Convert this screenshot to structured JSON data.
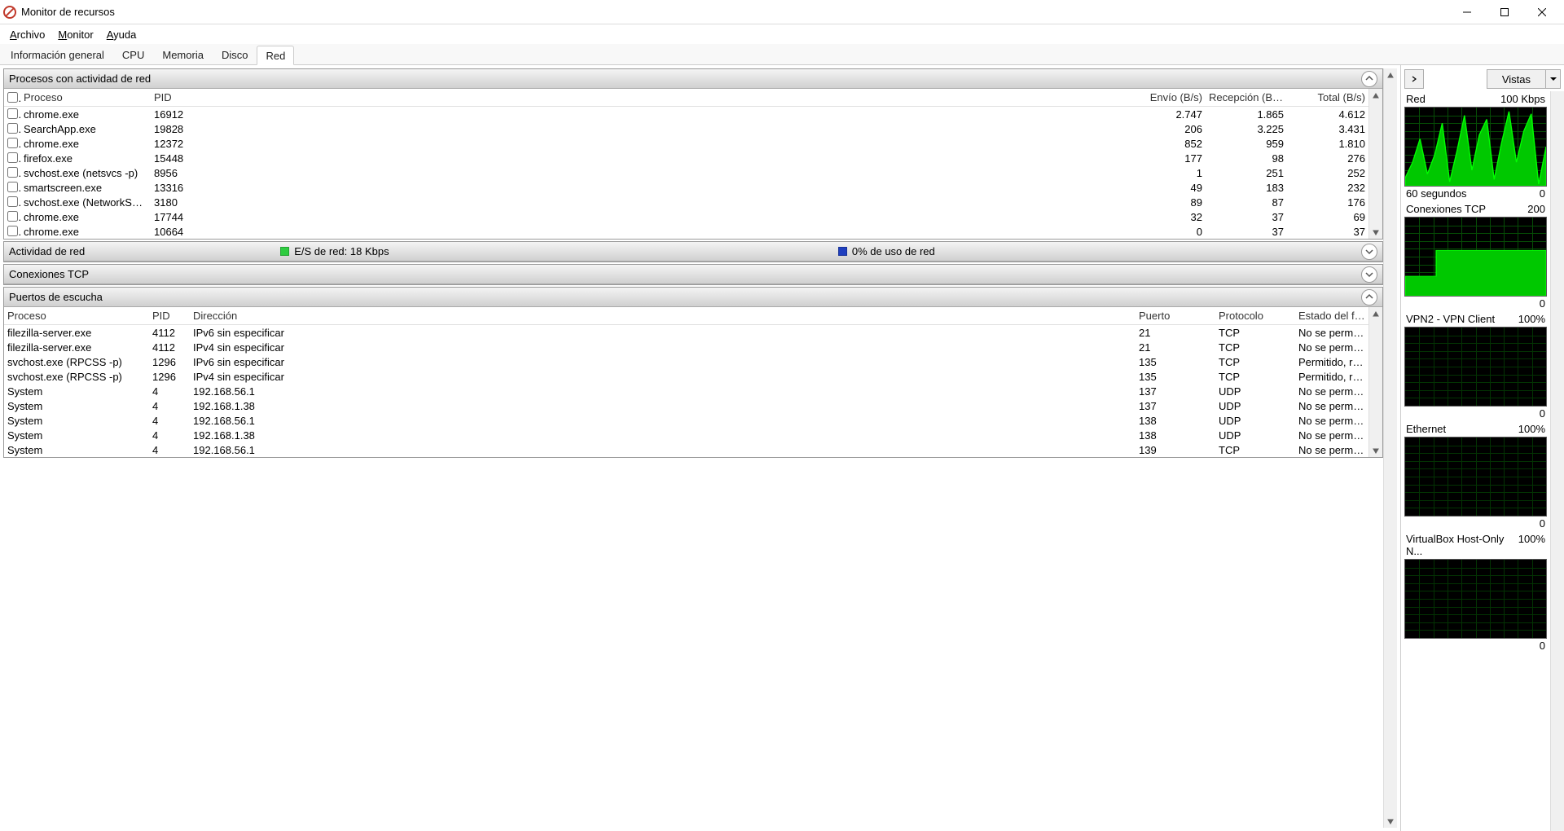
{
  "window": {
    "title": "Monitor de recursos"
  },
  "menus": [
    "Archivo",
    "Monitor",
    "Ayuda"
  ],
  "menu_mnemonics": [
    "A",
    "M",
    "A"
  ],
  "tabs": [
    {
      "label": "Información general",
      "mnemonic": "g",
      "active": false
    },
    {
      "label": "CPU",
      "active": false
    },
    {
      "label": "Memoria",
      "active": false
    },
    {
      "label": "Disco",
      "active": false
    },
    {
      "label": "Red",
      "active": true
    }
  ],
  "panels": {
    "processes": {
      "title": "Procesos con actividad de red",
      "columns": [
        "Proceso",
        "PID",
        "Envío (B/s)",
        "Recepción (B/s)",
        "Total (B/s)"
      ],
      "rows": [
        {
          "proc": "chrome.exe",
          "pid": "16912",
          "send": "2.747",
          "recv": "1.865",
          "total": "4.612"
        },
        {
          "proc": "SearchApp.exe",
          "pid": "19828",
          "send": "206",
          "recv": "3.225",
          "total": "3.431"
        },
        {
          "proc": "chrome.exe",
          "pid": "12372",
          "send": "852",
          "recv": "959",
          "total": "1.810"
        },
        {
          "proc": "firefox.exe",
          "pid": "15448",
          "send": "177",
          "recv": "98",
          "total": "276"
        },
        {
          "proc": "svchost.exe (netsvcs -p)",
          "pid": "8956",
          "send": "1",
          "recv": "251",
          "total": "252"
        },
        {
          "proc": "smartscreen.exe",
          "pid": "13316",
          "send": "49",
          "recv": "183",
          "total": "232"
        },
        {
          "proc": "svchost.exe (NetworkService -p)",
          "pid": "3180",
          "send": "89",
          "recv": "87",
          "total": "176"
        },
        {
          "proc": "chrome.exe",
          "pid": "17744",
          "send": "32",
          "recv": "37",
          "total": "69"
        },
        {
          "proc": "chrome.exe",
          "pid": "10664",
          "send": "0",
          "recv": "37",
          "total": "37"
        }
      ]
    },
    "activity": {
      "title": "Actividad de red",
      "io_label": "E/S de red: 18 Kbps",
      "io_color": "#2ecc40",
      "usage_label": "0% de uso de red",
      "usage_color": "#1f3fbf"
    },
    "tcp": {
      "title": "Conexiones TCP"
    },
    "ports": {
      "title": "Puertos de escucha",
      "columns": [
        "Proceso",
        "PID",
        "Dirección",
        "Puerto",
        "Protocolo",
        "Estado del firewall"
      ],
      "rows": [
        {
          "proc": "filezilla-server.exe",
          "pid": "4112",
          "dir": "IPv6 sin especificar",
          "port": "21",
          "proto": "TCP",
          "fw": "No se permite, n..."
        },
        {
          "proc": "filezilla-server.exe",
          "pid": "4112",
          "dir": "IPv4 sin especificar",
          "port": "21",
          "proto": "TCP",
          "fw": "No se permite, n..."
        },
        {
          "proc": "svchost.exe (RPCSS -p)",
          "pid": "1296",
          "dir": "IPv6 sin especificar",
          "port": "135",
          "proto": "TCP",
          "fw": "Permitido, restrin..."
        },
        {
          "proc": "svchost.exe (RPCSS -p)",
          "pid": "1296",
          "dir": "IPv4 sin especificar",
          "port": "135",
          "proto": "TCP",
          "fw": "Permitido, restrin..."
        },
        {
          "proc": "System",
          "pid": "4",
          "dir": "192.168.56.1",
          "port": "137",
          "proto": "UDP",
          "fw": "No se permite, n..."
        },
        {
          "proc": "System",
          "pid": "4",
          "dir": "192.168.1.38",
          "port": "137",
          "proto": "UDP",
          "fw": "No se permite, n..."
        },
        {
          "proc": "System",
          "pid": "4",
          "dir": "192.168.56.1",
          "port": "138",
          "proto": "UDP",
          "fw": "No se permite, n..."
        },
        {
          "proc": "System",
          "pid": "4",
          "dir": "192.168.1.38",
          "port": "138",
          "proto": "UDP",
          "fw": "No se permite, n..."
        },
        {
          "proc": "System",
          "pid": "4",
          "dir": "192.168.56.1",
          "port": "139",
          "proto": "TCP",
          "fw": "No se permite, n..."
        }
      ]
    }
  },
  "sidebar": {
    "views_label": "Vistas",
    "graphs": [
      {
        "title": "Red",
        "scale": "100 Kbps",
        "footer_left": "60 segundos",
        "footer_right": "0",
        "bright": true,
        "hasdata": true
      },
      {
        "title": "Conexiones TCP",
        "scale": "200",
        "footer_left": "",
        "footer_right": "0",
        "bright": true,
        "hasdata": true,
        "flat": true
      },
      {
        "title": "VPN2 - VPN Client",
        "scale": "100%",
        "footer_left": "",
        "footer_right": "0",
        "bright": false
      },
      {
        "title": "Ethernet",
        "scale": "100%",
        "footer_left": "",
        "footer_right": "0",
        "bright": false
      },
      {
        "title": "VirtualBox Host-Only N...",
        "scale": "100%",
        "footer_left": "",
        "footer_right": "0",
        "bright": false
      }
    ]
  }
}
